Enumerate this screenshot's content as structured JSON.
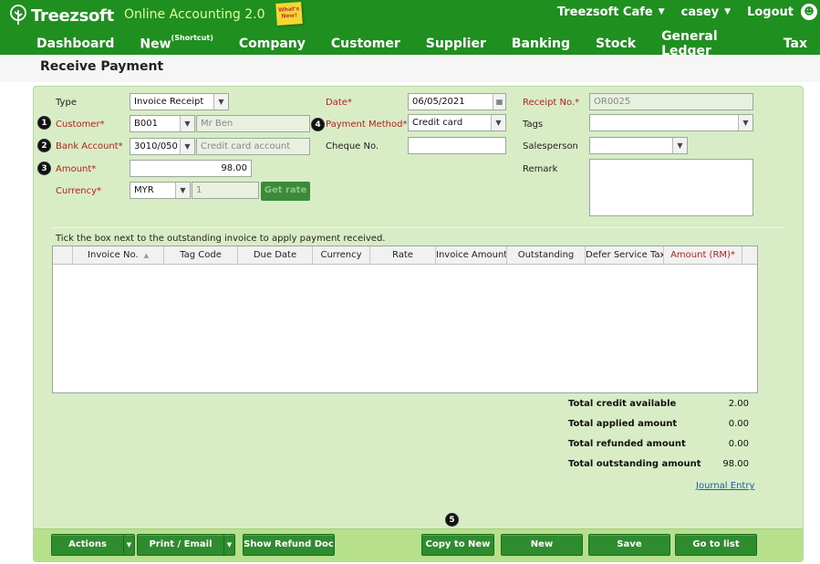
{
  "header": {
    "brand": "Treezsoft",
    "tagline": "Online Accounting 2.0",
    "whats_new": "What's New!",
    "company": "Treezsoft Cafe",
    "user": "casey",
    "logout": "Logout",
    "caret": "▼",
    "colors": {
      "bar": "#1f8f1f",
      "tagline": "#e6ff9a"
    }
  },
  "nav": {
    "dashboard": "Dashboard",
    "new": "New",
    "new_sup": "(Shortcut)",
    "company": "Company",
    "customer": "Customer",
    "supplier": "Supplier",
    "banking": "Banking",
    "stock": "Stock",
    "general_ledger": "General Ledger",
    "tax": "Tax"
  },
  "page": {
    "title": "Receive Payment"
  },
  "form": {
    "type_label": "Type",
    "type_value": "Invoice Receipt",
    "customer_label": "Customer*",
    "customer_code": "B001",
    "customer_name": "Mr Ben",
    "bank_label": "Bank Account*",
    "bank_code": "3010/050",
    "bank_name": "Credit card account",
    "amount_label": "Amount*",
    "amount_value": "98.00",
    "currency_label": "Currency*",
    "currency_value": "MYR",
    "rate_value": "1",
    "get_rate": "Get rate",
    "date_label": "Date*",
    "date_value": "06/05/2021",
    "payment_method_label": "Payment Method*",
    "payment_method_value": "Credit card",
    "cheque_label": "Cheque No.",
    "cheque_value": "",
    "receipt_label": "Receipt No.*",
    "receipt_value": "OR0025",
    "tags_label": "Tags",
    "tags_value": "",
    "salesperson_label": "Salesperson",
    "salesperson_value": "",
    "remark_label": "Remark",
    "remark_value": ""
  },
  "callouts": {
    "n1": "1",
    "n2": "2",
    "n3": "3",
    "n4": "4",
    "n5": "5"
  },
  "grid": {
    "instruction": "Tick the box next to the outstanding invoice to apply payment received.",
    "columns": [
      "Invoice No.",
      "Tag Code",
      "Due Date",
      "Currency",
      "Rate",
      "Invoice Amount",
      "Outstanding",
      "Defer Service Tax",
      "Amount (RM)*"
    ],
    "rows": []
  },
  "totals": {
    "credit_label": "Total credit available",
    "credit_value": "2.00",
    "applied_label": "Total applied amount",
    "applied_value": "0.00",
    "refunded_label": "Total refunded amount",
    "refunded_value": "0.00",
    "outstanding_label": "Total outstanding amount",
    "outstanding_value": "98.00",
    "journal_entry": "Journal Entry"
  },
  "actions": {
    "actions": "Actions",
    "print_email": "Print / Email",
    "show_refund": "Show Refund Doc",
    "copy_to_new": "Copy to New",
    "new": "New",
    "save": "Save",
    "go_to_list": "Go to list"
  },
  "icons": {
    "logo": "tree-logo-icon",
    "user": "user-icon",
    "dropdown": "chevron-down-icon",
    "calendar": "calendar-icon",
    "sort": "sort-asc-icon"
  }
}
